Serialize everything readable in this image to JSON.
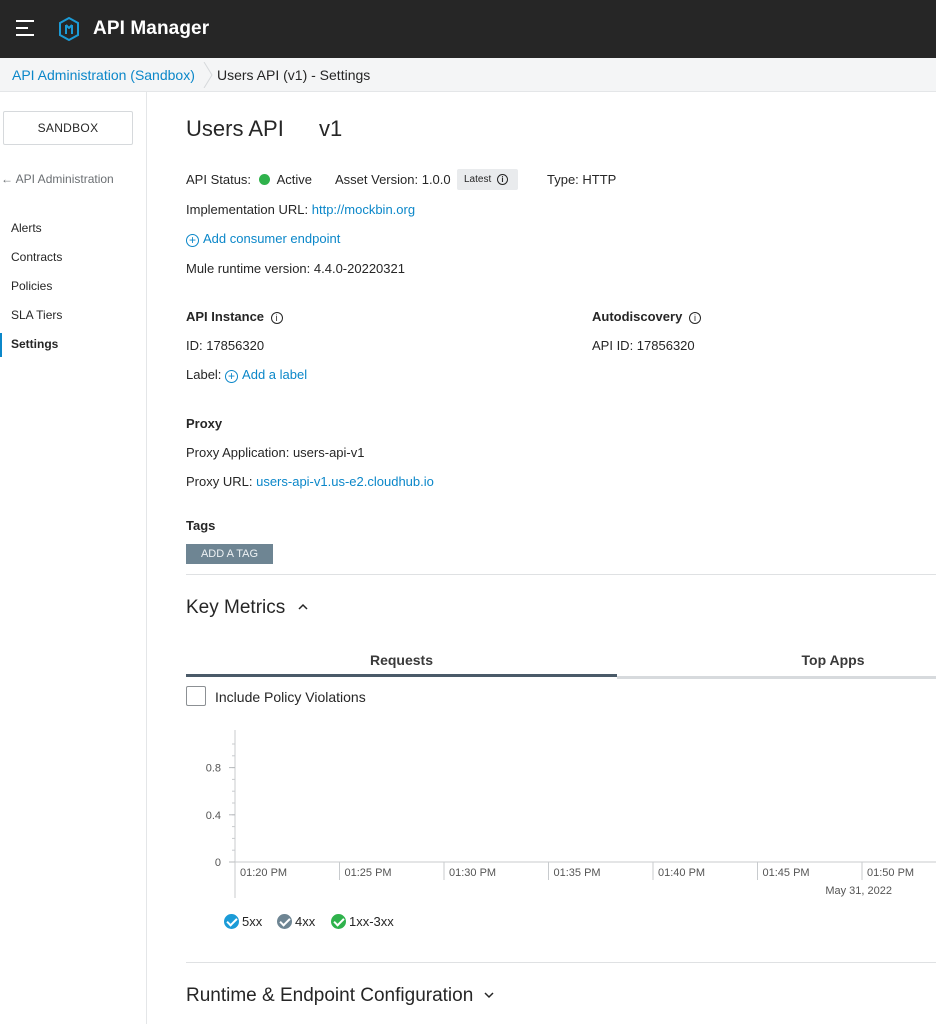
{
  "app": {
    "title": "API Manager"
  },
  "breadcrumb": {
    "parent": "API Administration (Sandbox)",
    "current": "Users API (v1) - Settings"
  },
  "sidebar": {
    "environment": "SANDBOX",
    "back_label": "← API Administration",
    "items": [
      {
        "label": "Alerts"
      },
      {
        "label": "Contracts"
      },
      {
        "label": "Policies"
      },
      {
        "label": "SLA Tiers"
      },
      {
        "label": "Settings",
        "active": true
      }
    ]
  },
  "api": {
    "name": "Users API",
    "version": "v1",
    "status_label": "API Status:",
    "status_value": "Active",
    "status_color": "#2fb24c",
    "asset_version_label": "Asset Version: 1.0.0",
    "latest_badge": "Latest",
    "type_label": "Type: HTTP",
    "implementation_label": "Implementation URL:",
    "implementation_url": "http://mockbin.org",
    "add_consumer_endpoint": "Add consumer endpoint",
    "mule_runtime": "Mule runtime version: 4.4.0-20220321"
  },
  "api_instance": {
    "heading": "API Instance",
    "id": "ID: 17856320",
    "label_prefix": "Label:",
    "add_label": "Add a label"
  },
  "autodiscovery": {
    "heading": "Autodiscovery",
    "api_id": "API ID: 17856320"
  },
  "proxy": {
    "heading": "Proxy",
    "application": "Proxy Application: users-api-v1",
    "url_label": "Proxy URL:",
    "url": "users-api-v1.us-e2.cloudhub.io"
  },
  "tags": {
    "heading": "Tags",
    "add_button": "ADD A TAG"
  },
  "key_metrics": {
    "heading": "Key Metrics",
    "tabs": [
      {
        "label": "Requests",
        "active": true
      },
      {
        "label": "Top Apps"
      }
    ],
    "include_policy_violations": "Include Policy Violations",
    "legend": [
      {
        "label": "5xx",
        "color": "#1b9bd7"
      },
      {
        "label": "4xx",
        "color": "#6e8593"
      },
      {
        "label": "1xx-3xx",
        "color": "#2fb24c"
      }
    ]
  },
  "runtime_section": {
    "heading": "Runtime & Endpoint Configuration"
  },
  "chart_data": {
    "type": "line",
    "x": [
      "01:20 PM",
      "01:25 PM",
      "01:30 PM",
      "01:35 PM",
      "01:40 PM",
      "01:45 PM",
      "01:50 PM"
    ],
    "date_label": "May 31, 2022",
    "y_ticks": [
      "0.8",
      "0.4",
      "0"
    ],
    "ylim": [
      0,
      1
    ],
    "series": [],
    "grid": false
  }
}
